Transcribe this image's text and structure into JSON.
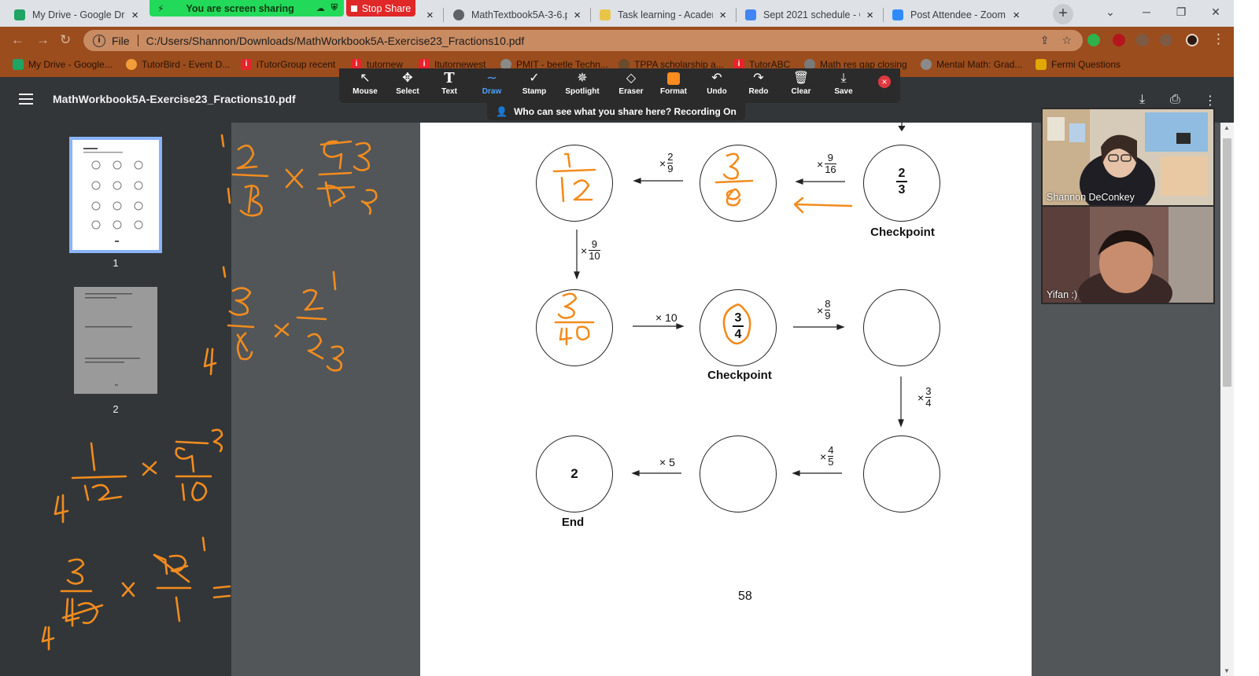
{
  "tabs": [
    {
      "title": "My Drive - Google Drive",
      "color": "#1fa463"
    },
    {
      "title": "",
      "color": "#4a8af4"
    },
    {
      "title": "MathTextbook5A-3-6.pdf",
      "color": "#5f6368"
    },
    {
      "title": "Task learning - Academic",
      "color": "#e8c547"
    },
    {
      "title": "Sept 2021 schedule - Google",
      "color": "#4285f4"
    },
    {
      "title": "Post Attendee - Zoom",
      "color": "#2d8cff"
    }
  ],
  "share": {
    "banner": "You are screen sharing",
    "stop": "Stop Share"
  },
  "address": {
    "scheme": "File",
    "url": "C:/Users/Shannon/Downloads/MathWorkbook5A-Exercise23_Fractions10.pdf"
  },
  "bookmarks": [
    {
      "label": "My Drive - Google...",
      "color": "#1fa463",
      "glyph": ""
    },
    {
      "label": "TutorBird - Event D...",
      "color": "#f29d38",
      "glyph": ""
    },
    {
      "label": "iTutorGroup recent",
      "color": "#e8232b",
      "glyph": "i"
    },
    {
      "label": "tutornew",
      "color": "#e8232b",
      "glyph": "i"
    },
    {
      "label": "Itutornewest",
      "color": "#e8232b",
      "glyph": "i"
    },
    {
      "label": "PMIT - beetle Techn...",
      "color": "#8a8a8a",
      "glyph": ""
    },
    {
      "label": "TPPA scholarship a...",
      "color": "#6b4b2b",
      "glyph": ""
    },
    {
      "label": "TutorABC",
      "color": "#e8232b",
      "glyph": "i"
    },
    {
      "label": "Math res gap closing",
      "color": "#7a7a7a",
      "glyph": ""
    },
    {
      "label": "Mental Math: Grad...",
      "color": "#8a8a8a",
      "glyph": ""
    },
    {
      "label": "Fermi Questions",
      "color": "#e0a800",
      "glyph": ""
    }
  ],
  "pdf": {
    "title": "MathWorkbook5A-Exercise23_Fractions10.pdf",
    "page_number": "58",
    "thumbnails": [
      "1",
      "2"
    ]
  },
  "annotate_tools": [
    {
      "label": "Mouse",
      "icon": "↖"
    },
    {
      "label": "Select",
      "icon": "✥"
    },
    {
      "label": "Text",
      "icon": "T"
    },
    {
      "label": "Draw",
      "icon": "∼"
    },
    {
      "label": "Stamp",
      "icon": "✓"
    },
    {
      "label": "Spotlight",
      "icon": "✵"
    },
    {
      "label": "Eraser",
      "icon": "◇"
    },
    {
      "label": "Format",
      "icon": "■"
    },
    {
      "label": "Undo",
      "icon": "↶"
    },
    {
      "label": "Redo",
      "icon": "↷"
    },
    {
      "label": "Clear",
      "icon": "␡"
    },
    {
      "label": "Save",
      "icon": "⤓"
    }
  ],
  "active_tool": "Draw",
  "accent": {
    "annotation_ink": "#f28c1e",
    "active_tool": "#4fa3ff",
    "format_swatch": "#ff8a1f"
  },
  "recording_notice": "Who can see what you share here? Recording On",
  "worksheet": {
    "circles": [
      {
        "id": "c1",
        "num": "",
        "den": "",
        "whole": ""
      },
      {
        "id": "c2",
        "num": "",
        "den": "",
        "whole": ""
      },
      {
        "id": "c3",
        "num": "2",
        "den": "3",
        "whole": ""
      },
      {
        "id": "c4",
        "num": "",
        "den": "",
        "whole": ""
      },
      {
        "id": "c5",
        "num": "3",
        "den": "4",
        "whole": ""
      },
      {
        "id": "c6",
        "num": "",
        "den": "",
        "whole": ""
      },
      {
        "id": "c7",
        "num": "",
        "den": "",
        "whole": "2"
      },
      {
        "id": "c8",
        "num": "",
        "den": "",
        "whole": ""
      },
      {
        "id": "c9",
        "num": "",
        "den": "",
        "whole": ""
      }
    ],
    "operators": [
      {
        "id": "op1",
        "sign": "×",
        "num": "2",
        "den": "9"
      },
      {
        "id": "op2",
        "sign": "×",
        "num": "9",
        "den": "16"
      },
      {
        "id": "op3",
        "sign": "×",
        "num": "9",
        "den": "10"
      },
      {
        "id": "op4",
        "sign": "× 10",
        "num": "",
        "den": ""
      },
      {
        "id": "op5",
        "sign": "×",
        "num": "8",
        "den": "9"
      },
      {
        "id": "op6",
        "sign": "×",
        "num": "3",
        "den": "4"
      },
      {
        "id": "op7",
        "sign": "×",
        "num": "4",
        "den": "5"
      },
      {
        "id": "op8",
        "sign": "× 5",
        "num": "",
        "den": ""
      }
    ],
    "captions": {
      "checkpoint_top": "Checkpoint",
      "checkpoint_mid": "Checkpoint",
      "end": "End"
    }
  },
  "handwriting": {
    "ans1": {
      "num": "1",
      "den": "12"
    },
    "ans2": {
      "num": "3",
      "den": "8"
    },
    "ans3": {
      "num": "3",
      "den": "40"
    }
  },
  "participants": [
    {
      "name": "Shannon DeConkey"
    },
    {
      "name": "Yifan :)"
    }
  ]
}
